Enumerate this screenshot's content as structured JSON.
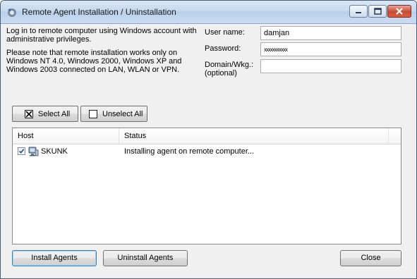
{
  "window": {
    "title": "Remote Agent Installation / Uninstallation"
  },
  "info": {
    "line1": "Log in to remote computer using Windows account with administrative privileges.",
    "line2": "Please note that remote installation works only on Windows NT 4.0, Windows 2000, Windows XP and Windows 2003 connected on LAN, WLAN or VPN."
  },
  "credentials": {
    "username_label": "User name:",
    "username_value": "damjan",
    "password_label": "Password:",
    "password_value": "xxxxxxxxxxx",
    "domain_label_1": "Domain/Wkg.:",
    "domain_label_2": "(optional)",
    "domain_value": ""
  },
  "selection": {
    "select_all": "Select All",
    "unselect_all": "Unselect All"
  },
  "table": {
    "columns": [
      "Host",
      "Status"
    ],
    "rows": [
      {
        "host": "SKUNK",
        "status": "Installing agent on remote computer...",
        "checked": true
      }
    ]
  },
  "buttons": {
    "install": "Install Agents",
    "uninstall": "Uninstall Agents",
    "close": "Close"
  },
  "icons": {
    "app": "agent-icon",
    "computer": "computer-icon"
  }
}
